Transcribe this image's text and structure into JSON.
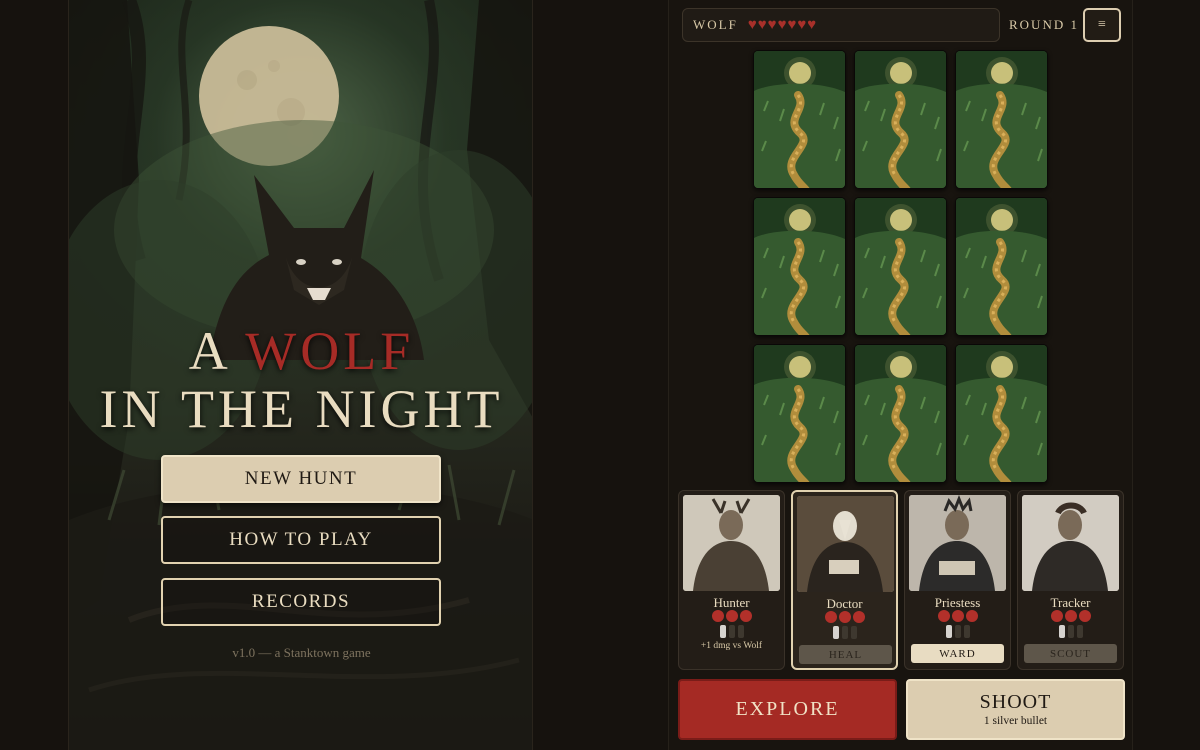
{
  "title_screen": {
    "title_line1_prefix": "A",
    "title_line1_accent": "WOLF",
    "title_line2": "IN THE NIGHT",
    "buttons": {
      "new_hunt": "NEW HUNT",
      "how_to_play": "HOW TO PLAY",
      "records": "RECORDS"
    },
    "version": "v1.0 — a Stanktown game"
  },
  "game": {
    "wolf_label": "WOLF",
    "wolf_hearts": 7,
    "heart_glyph": "♥",
    "round_label": "ROUND 1",
    "menu_icon_glyph": "≡",
    "cards": [
      "forest-path",
      "forest-path",
      "forest-path",
      "forest-path",
      "forest-path",
      "forest-path",
      "forest-path",
      "forest-path",
      "forest-path"
    ],
    "party": [
      {
        "name": "Hunter",
        "hp": 3,
        "ammo_full": 1,
        "ammo_total": 3,
        "note": "+1 dmg vs Wolf",
        "ability": "",
        "selected": false
      },
      {
        "name": "Doctor",
        "hp": 3,
        "ammo_full": 1,
        "ammo_total": 3,
        "note": "",
        "ability": "HEAL",
        "ability_state": "dim",
        "selected": true
      },
      {
        "name": "Priestess",
        "hp": 3,
        "ammo_full": 1,
        "ammo_total": 3,
        "note": "",
        "ability": "WARD",
        "ability_state": "active",
        "selected": false
      },
      {
        "name": "Tracker",
        "hp": 3,
        "ammo_full": 1,
        "ammo_total": 3,
        "note": "",
        "ability": "SCOUT",
        "ability_state": "dim",
        "selected": false
      }
    ],
    "explore_label": "EXPLORE",
    "shoot_label": "SHOOT",
    "shoot_sub": "1 silver bullet"
  },
  "colors": {
    "accent_red": "#a52a24",
    "parchment": "#dccdb0",
    "background": "#16120e"
  }
}
